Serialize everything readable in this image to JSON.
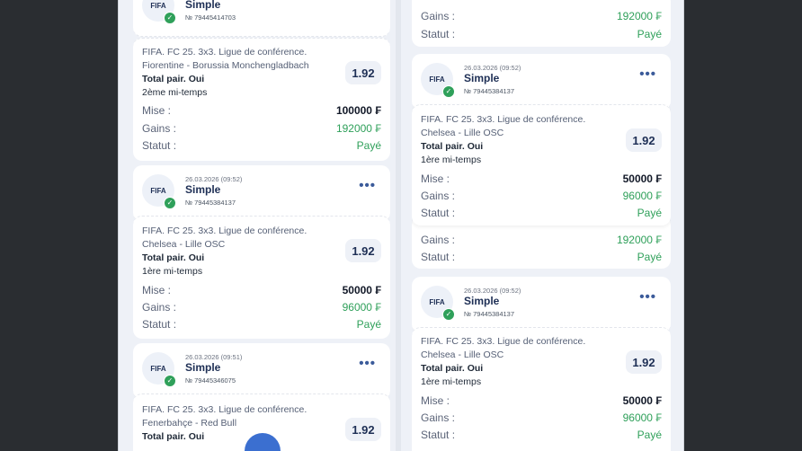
{
  "logo_text": "FIFA",
  "check_mark": "✓",
  "more_glyph": "•••",
  "labels": {
    "stake": "Mise :",
    "winnings": "Gains :",
    "status": "Statut :"
  },
  "left": {
    "card1": {
      "type": "Simple",
      "number": "№ 79445414703",
      "event": "FIFA. FC 25. 3x3. Ligue de conférence.",
      "match": "Fiorentine - Borussia Monchengladbach",
      "bet": "Total pair. Oui",
      "period": "2ème mi-temps",
      "odds": "1.92",
      "stake": "100000 ₣",
      "winnings": "192000 ₣",
      "status": "Payé"
    },
    "card2": {
      "date": "26.03.2026 (09:52)",
      "type": "Simple",
      "number": "№ 79445384137",
      "event": "FIFA. FC 25. 3x3. Ligue de conférence.",
      "match": "Chelsea - Lille OSC",
      "bet": "Total pair. Oui",
      "period": "1ère mi-temps",
      "odds": "1.92",
      "stake": "50000 ₣",
      "winnings": "96000 ₣",
      "status": "Payé"
    },
    "card3": {
      "date": "26.03.2026 (09:51)",
      "type": "Simple",
      "number": "№ 79445346075",
      "event": "FIFA. FC 25. 3x3. Ligue de conférence.",
      "match": "Fenerbahçe - Red Bull",
      "bet": "Total pair. Oui",
      "odds": "1.92"
    }
  },
  "right": {
    "card0": {
      "winnings": "192000 ₣",
      "status": "Payé"
    },
    "card1": {
      "date": "26.03.2026 (09:52)",
      "type": "Simple",
      "number": "№ 79445384137",
      "event": "FIFA. FC 25. 3x3. Ligue de conférence.",
      "match": "Chelsea - Lille OSC",
      "bet": "Total pair. Oui",
      "period": "1ère mi-temps",
      "odds": "1.92",
      "stake": "50000 ₣",
      "winnings": "96000 ₣",
      "status": "Payé"
    },
    "card1b": {
      "winnings": "192000 ₣",
      "status": "Payé"
    },
    "card2": {
      "date": "26.03.2026 (09:52)",
      "type": "Simple",
      "number": "№ 79445384137",
      "event": "FIFA. FC 25. 3x3. Ligue de conférence.",
      "match": "Chelsea - Lille OSC",
      "bet": "Total pair. Oui",
      "period": "1ère mi-temps",
      "odds": "1.92",
      "stake": "50000 ₣",
      "winnings": "96000 ₣",
      "status": "Payé"
    }
  },
  "colors": {
    "accent": "#1e2f55",
    "paid": "#2fa05a",
    "fab": "#3b6fd0"
  }
}
